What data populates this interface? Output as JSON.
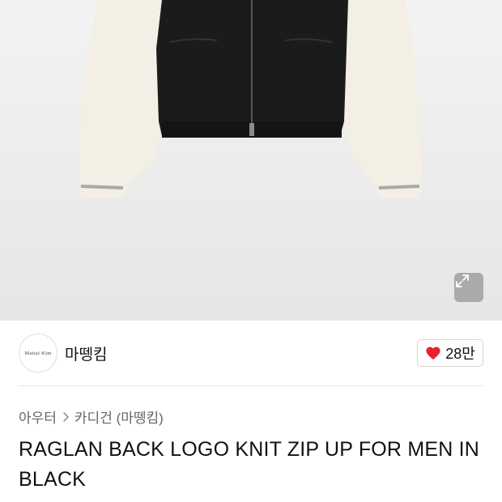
{
  "product_image": {
    "alt": "",
    "expand_icon": "expand-arrows-icon"
  },
  "brand": {
    "logo_text": "Mattai Kim",
    "name": "마뗑킴"
  },
  "like": {
    "icon": "heart-icon",
    "count": "28만",
    "color": "#e8212b"
  },
  "breadcrumb": {
    "items": [
      "아우터",
      "카디건 (마뗑킴)"
    ],
    "separator_icon": "chevron-right-icon"
  },
  "product": {
    "title": "RAGLAN BACK LOGO KNIT ZIP UP FOR MEN IN BLACK"
  }
}
